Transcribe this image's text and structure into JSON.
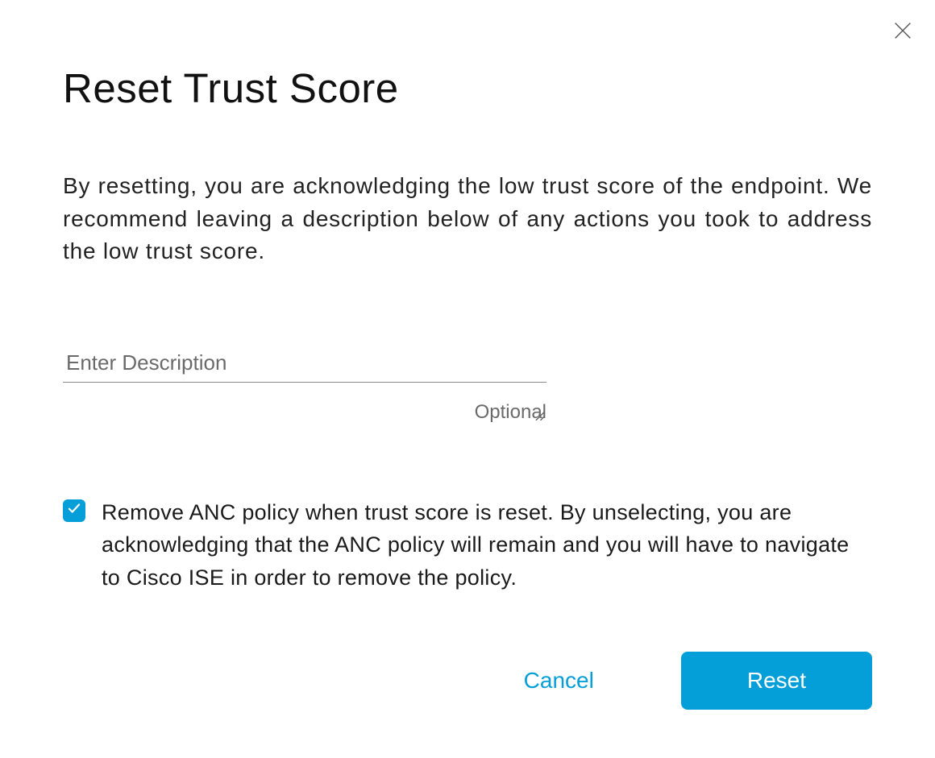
{
  "dialog": {
    "title": "Reset Trust Score",
    "description": "By resetting, you are acknowledging the low trust score of the endpoint. We recommend leaving a description below of any actions you took to address the low trust score.",
    "input": {
      "placeholder": "Enter Description",
      "value": "",
      "hint": "Optional"
    },
    "checkbox": {
      "checked": true,
      "label": "Remove ANC policy when trust score is reset. By unselecting, you are acknowledging that the ANC policy will remain and you will have to navigate to Cisco ISE in order to remove the policy."
    },
    "buttons": {
      "cancel": "Cancel",
      "submit": "Reset"
    }
  },
  "colors": {
    "accent": "#049fd9"
  }
}
